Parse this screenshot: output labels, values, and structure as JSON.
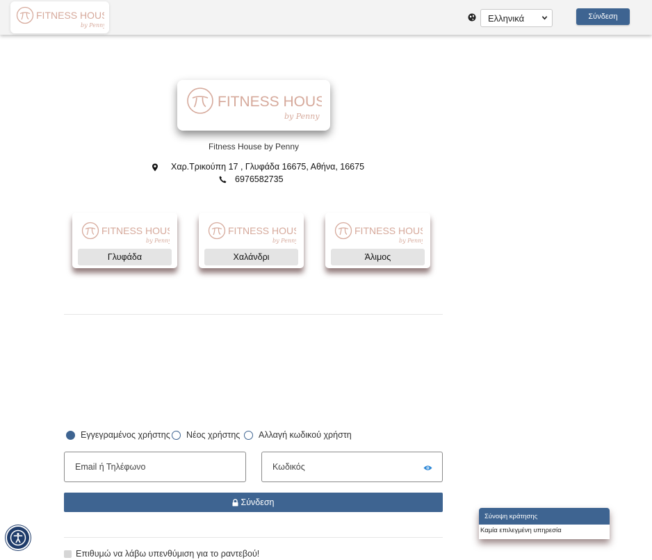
{
  "brand": {
    "logo_word": "FITNESS HOUSE",
    "logo_tagline": "by Penny",
    "logo_color": "#d6a99b"
  },
  "header": {
    "language_selected": "Ελληνικά",
    "login_label": "Σύνδεση"
  },
  "business": {
    "name": "Fitness House by Penny",
    "address": "Χαρ.Τρικούπη 17 , Γλυφάδα 16675, Αθήνα, 16675",
    "phone": "6976582735"
  },
  "branches": [
    {
      "label": "Γλυφάδα"
    },
    {
      "label": "Χαλάνδρι"
    },
    {
      "label": "Άλιμος"
    }
  ],
  "login_form": {
    "options": [
      {
        "label": "Εγγεγραμένος χρήστης",
        "selected": true
      },
      {
        "label": "Νέος χρήστης",
        "selected": false
      },
      {
        "label": "Αλλαγή κωδικού χρήστη",
        "selected": false
      }
    ],
    "email_placeholder": "Email ή Τηλέφωνο",
    "password_placeholder": "Κωδικός",
    "submit_label": "Σύνδεση",
    "reminder_label": "Επιθυμώ να λάβω υπενθύμιση για το ραντεβού!"
  },
  "booking_summary": {
    "title": "Σύνοψη κράτησης",
    "empty_text": "Καμία επιλεγμένη υπηρεσία"
  },
  "colors": {
    "accent": "#3e6491",
    "topbar_bg": "#f3f3f3"
  }
}
